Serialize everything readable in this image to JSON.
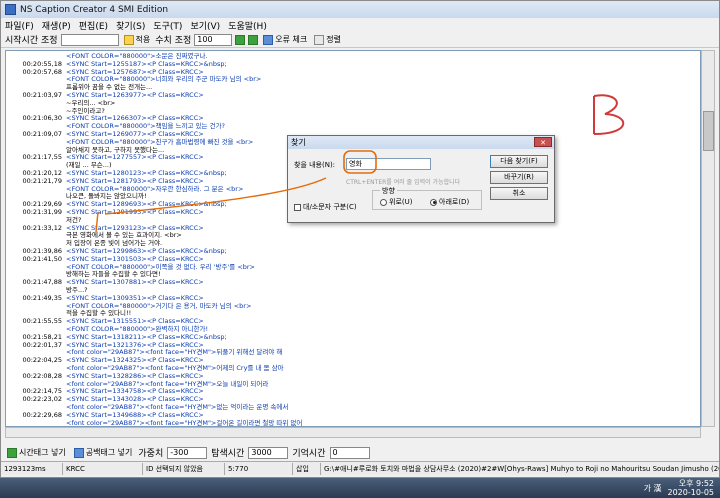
{
  "window": {
    "title": "NS Caption Creator 4 SMI Edition"
  },
  "menu": [
    "파일(F)",
    "재생(P)",
    "편집(E)",
    "찾기(S)",
    "도구(T)",
    "보기(V)",
    "도움말(H)"
  ],
  "toolbar": {
    "start_label": "시작시간 조정",
    "apply_label": "적용",
    "number_label": "수치 조정",
    "number_value": "100",
    "error_check": "오류 체크",
    "sort": "정렬"
  },
  "lines": [
    {
      "ts": "",
      "code": "<FONT COLOR=\"880000\">소문은 진짜였구나."
    },
    {
      "ts": "00:20:55,18",
      "code": "<SYNC Start=1255187><P Class=KRCC>&nbsp;"
    },
    {
      "ts": "00:20:57,68",
      "code": "<SYNC Start=1257687><P Class=KRCC>"
    },
    {
      "ts": "",
      "code": "<FONT COLOR=\"880000\">너희와 우리의 주군 마도카 님의 <br>"
    },
    {
      "ts": "",
      "code": "프롬위아 꿈을 수 없는 전개는..."
    },
    {
      "ts": "00:21:03,97",
      "code": "<SYNC Start=1263977><P Class=KRCC>"
    },
    {
      "ts": "",
      "code": "~우리의... <br>"
    },
    {
      "ts": "",
      "code": "~주인이라고?"
    },
    {
      "ts": "00:21:06,30",
      "code": "<SYNC Start=1266307><P Class=KRCC>"
    },
    {
      "ts": "",
      "code": "<FONT COLOR=\"880000\">책임을 느끼고 있는 건가?"
    },
    {
      "ts": "00:21:09,07",
      "code": "<SYNC Start=1269077><P Class=KRCC>"
    },
    {
      "ts": "",
      "code": "<FONT COLOR=\"880000\">친구가 흡마법령에 빠진 것을 <br>"
    },
    {
      "ts": "",
      "code": "알아채지 못하고, 구하지 못했다는..."
    },
    {
      "ts": "00:21:17,55",
      "code": "<SYNC Start=1277557><P Class=KRCC>"
    },
    {
      "ts": "",
      "code": "(재일 ... 무슨...)"
    },
    {
      "ts": "00:21:20,12",
      "code": "<SYNC Start=1280123><P Class=KRCC>&nbsp;"
    },
    {
      "ts": "00:21:21,79",
      "code": "<SYNC Start=1281793><P Class=KRCC>"
    },
    {
      "ts": "",
      "code": "<FONT COLOR=\"880000\">자우깐 한심하라. 그 분은 <br>"
    },
    {
      "ts": "",
      "code": "나오큰, 돌봐지는 않았으니까!"
    },
    {
      "ts": "00:21:29,69",
      "code": "<SYNC Start=1289693><P Class=KRCC>&nbsp;"
    },
    {
      "ts": "00:21:31,99",
      "code": "<SYNC Start=1291993><P Class=KRCC>"
    },
    {
      "ts": "",
      "code": "저건?"
    },
    {
      "ts": "00:21:33,12",
      "code": "<SYNC Start=1293123><P Class=KRCC>"
    },
    {
      "ts": "",
      "code": "극본 영화에서 볼 수 있는 효과이지. <br>"
    },
    {
      "ts": "",
      "code": "저 입장이 온종 빛이 넘어가는 거야."
    },
    {
      "ts": "00:21:39,86",
      "code": "<SYNC Start=1299863><P Class=KRCC>&nbsp;"
    },
    {
      "ts": "00:21:41,50",
      "code": "<SYNC Start=1301503><P Class=KRCC>"
    },
    {
      "ts": "",
      "code": "<FONT COLOR=\"880000\">이쪽을 것 없다. 우리 '방주'를 <br>"
    },
    {
      "ts": "",
      "code": "방해하는 자들을 수집할 수 있다면!"
    },
    {
      "ts": "00:21:47,88",
      "code": "<SYNC Start=1307881><P Class=KRCC>"
    },
    {
      "ts": "",
      "code": "방주...?"
    },
    {
      "ts": "00:21:49,35",
      "code": "<SYNC Start=1309351><P Class=KRCC>"
    },
    {
      "ts": "",
      "code": "<FONT COLOR=\"880000\">거기다 은 용거, 마도카 님의 <br>"
    },
    {
      "ts": "",
      "code": "적을 수집할 수 있다니!!"
    },
    {
      "ts": "00:21:55,55",
      "code": "<SYNC Start=1315551><P Class=KRCC>"
    },
    {
      "ts": "",
      "code": "<FONT COLOR=\"880000\">완벽하지 아니한가!"
    },
    {
      "ts": "00:21:58,21",
      "code": "<SYNC Start=1318211><P Class=KRCC>&nbsp;"
    },
    {
      "ts": "00:22:01,37",
      "code": "<SYNC Start=1321376><P Class=KRCC>"
    },
    {
      "ts": "",
      "code": "<font color=\"29AB87\"><font face=\"HY견M\">뒤풀기 위해선 달려야 해"
    },
    {
      "ts": "00:22:04,25",
      "code": "<SYNC Start=1324325><P Class=KRCC>"
    },
    {
      "ts": "",
      "code": "<font color=\"29AB87\"><font face=\"HY견M\">어제의 Cry를 내 몸 삼아"
    },
    {
      "ts": "00:22:08,28",
      "code": "<SYNC Start=1328286><P Class=KRCC>"
    },
    {
      "ts": "",
      "code": "<font color=\"29AB87\"><font face=\"HY견M\">오늘 내일이 되어라"
    },
    {
      "ts": "00:22:14,75",
      "code": "<SYNC Start=1334758><P Class=KRCC>"
    },
    {
      "ts": "00:22:23,02",
      "code": "<SYNC Start=1343028><P Class=KRCC>"
    },
    {
      "ts": "",
      "code": "<font color=\"29AB87\"><font face=\"HY견M\">없는 억이라는 운명 속에서"
    },
    {
      "ts": "00:22:29,68",
      "code": "<SYNC Start=1349688><P Class=KRCC>"
    },
    {
      "ts": "",
      "code": "<font color=\"29AB87\"><font face=\"HY견M\">걸어온 길이라면 철망 따위 없어"
    }
  ],
  "bottom_bar": {
    "tag_label": "시간태그 넣기",
    "line_tag": "공백태그 넣기",
    "gap_label": "가중치",
    "gap_value": "-300",
    "search_label": "탐색시간",
    "search_value": "3000",
    "memory_label": "기억시간",
    "memory_value": "0"
  },
  "status": {
    "time": "1293123ms",
    "class": "KRCC",
    "sync": "ID 선택되지 않았음",
    "count": "5:770",
    "mode": "삽입",
    "file": "G:\\#애니#루로화 토치와 마법을 상담사무소 (2020)#2#W[Ohys-Raws] Muhyo to Roji no Mahouritsu Soudan Jimusho (201"
  },
  "dialog": {
    "title": "찾기",
    "find_label": "찾을 내용(N):",
    "find_value": "영화",
    "hint": "CTRL+ENTER를 여러 줄 입력이 가능합니다",
    "case_label": "대/소문자 구분(C)",
    "direction_label": "방향",
    "up_label": "위로(U)",
    "down_label": "아래로(D)",
    "next_button": "다음 찾기(F)",
    "replace_button": "바꾸기(R)",
    "cancel_button": "취소"
  },
  "annotation": {
    "letter": "B"
  },
  "taskbar": {
    "lang": "가 漢",
    "time": "오후 9:52",
    "date": "2020-10-05"
  },
  "colors": {
    "code": "#0a3bb0",
    "highlight": "#e46c0a"
  }
}
